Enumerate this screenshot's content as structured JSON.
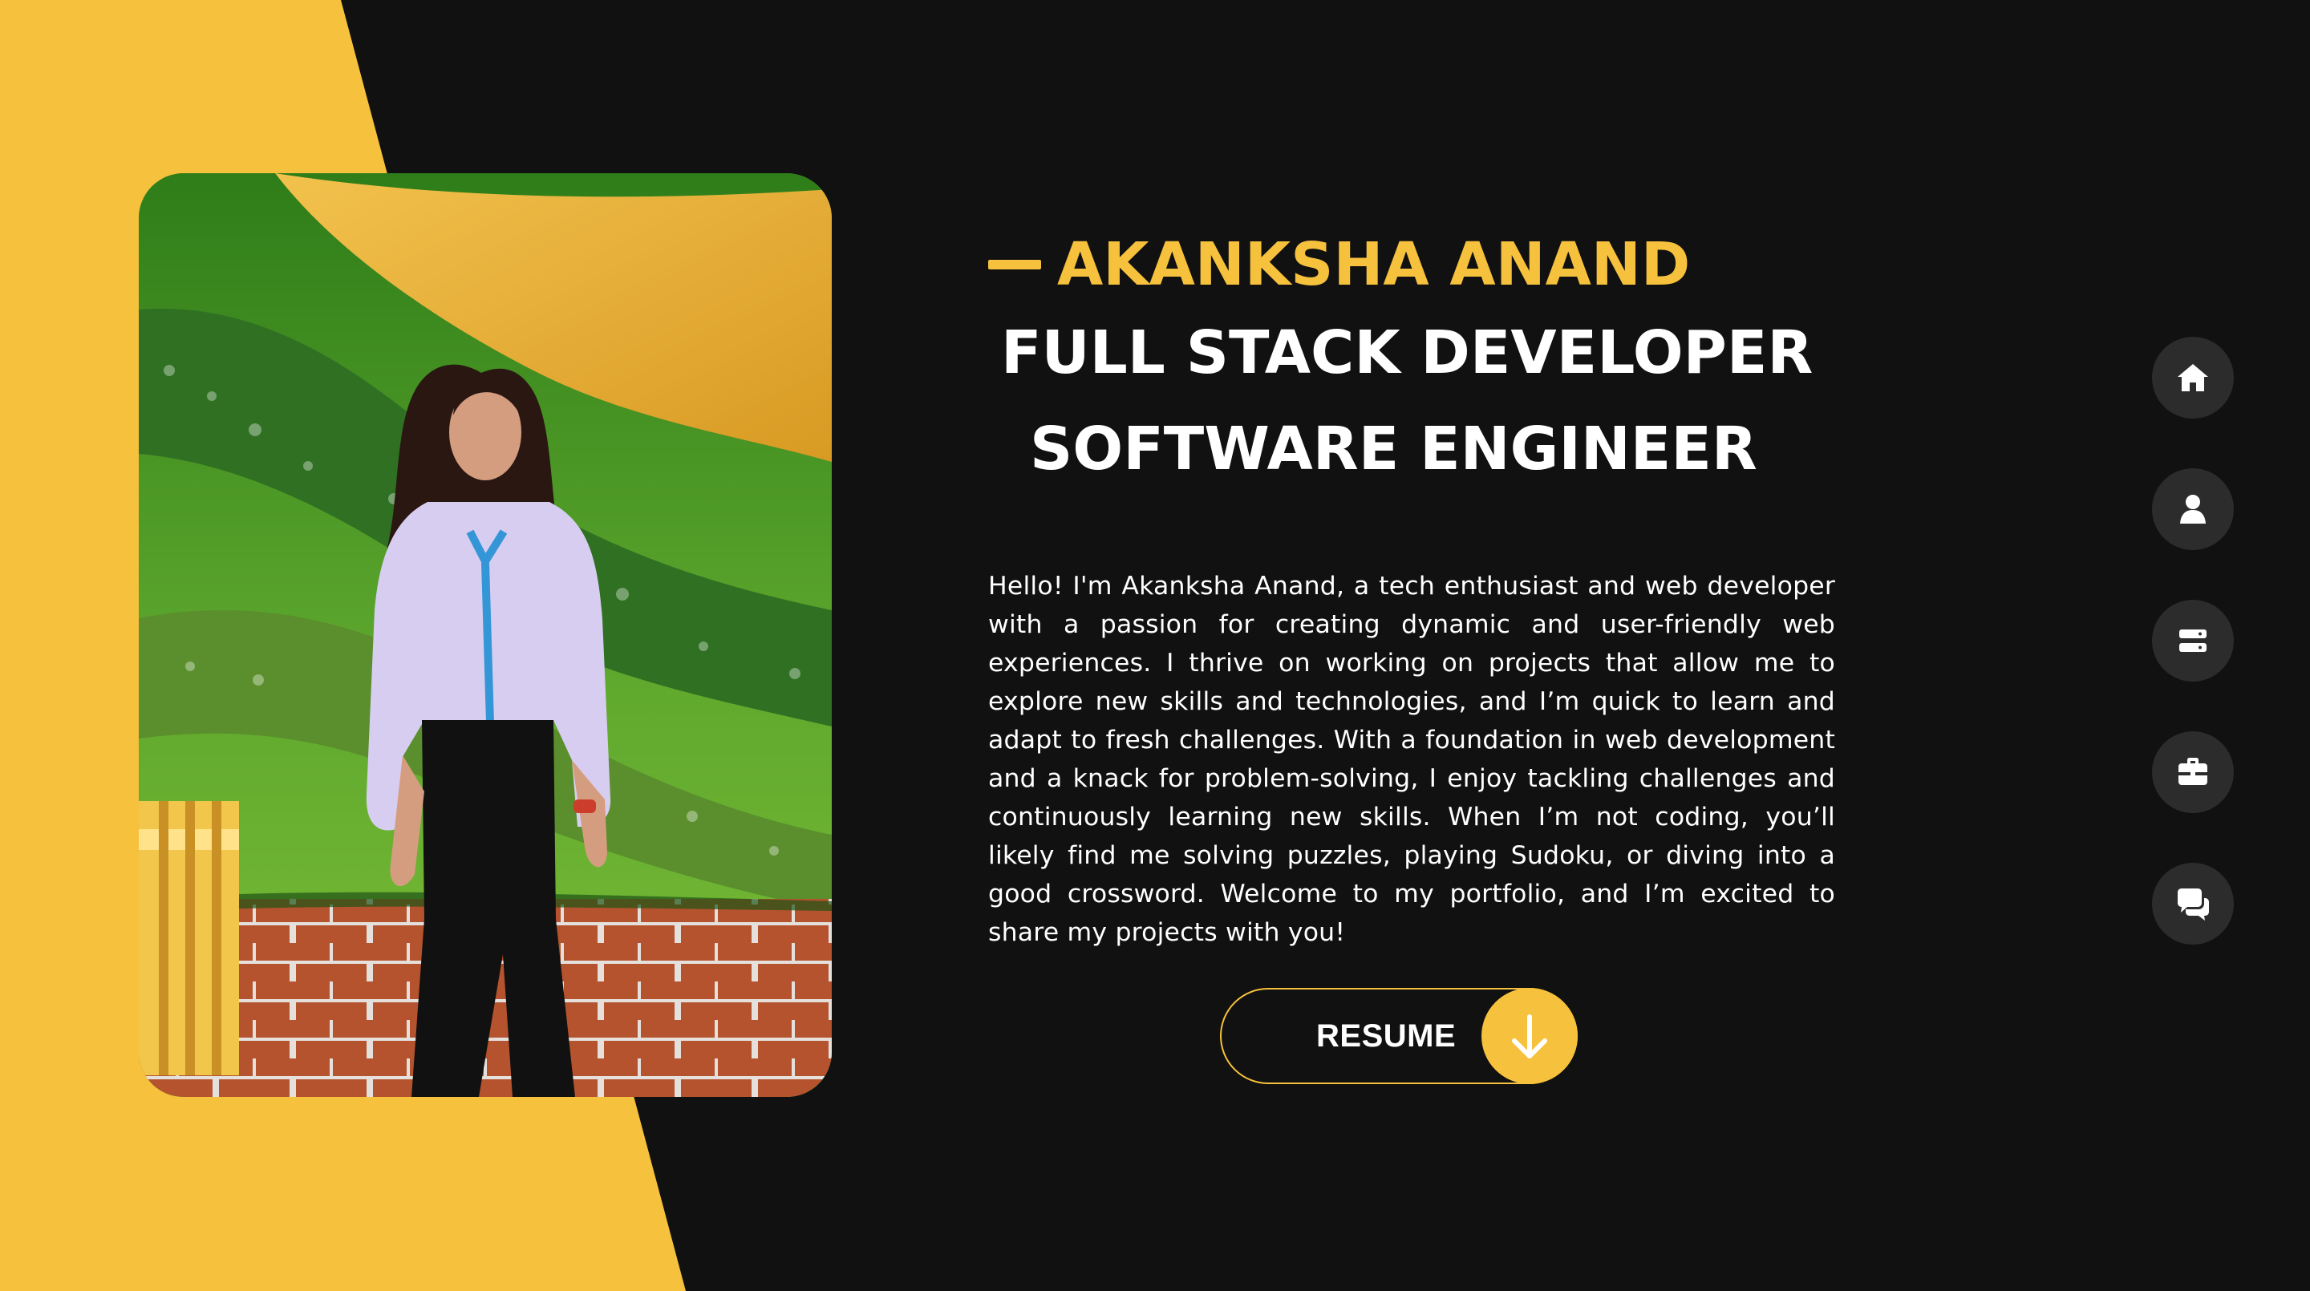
{
  "colors": {
    "accent": "#f6c13c",
    "background": "#111111",
    "nav_circle": "#2c2c2c",
    "text": "#ffffff"
  },
  "hero": {
    "name": "AKANKSHA ANAND",
    "roles": [
      "FULL STACK DEVELOPER",
      "SOFTWARE ENGINEER"
    ],
    "bio": "Hello! I'm Akanksha Anand, a tech enthusiast and web developer with a passion for creating dynamic and user-friendly web experiences. I thrive on working on projects that allow me to explore new skills and technologies, and I’m quick to learn and adapt to fresh challenges. With a foundation in web development and a knack for problem-solving, I enjoy tackling challenges and continuously learning new skills. When I’m not coding, you’ll likely find me solving puzzles, playing Sudoku, or diving into a good crossword. Welcome to my portfolio, and I’m excited to share my projects with you!",
    "resume_label": "RESUME",
    "resume_icon": "arrow-down-icon"
  },
  "profile_photo": {
    "icon": "profile-photo"
  },
  "side_nav": [
    {
      "icon": "home-icon"
    },
    {
      "icon": "user-icon"
    },
    {
      "icon": "server-icon"
    },
    {
      "icon": "briefcase-icon"
    },
    {
      "icon": "chat-icon"
    }
  ]
}
